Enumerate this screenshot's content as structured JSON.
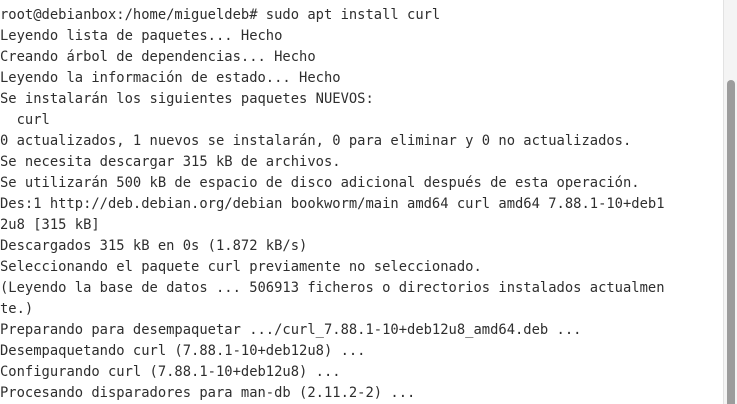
{
  "terminal": {
    "lines": [
      "\u0000",
      "root@debianbox:/home/migueldeb# sudo apt install curl",
      "Leyendo lista de paquetes... Hecho",
      "Creando árbol de dependencias... Hecho",
      "Leyendo la información de estado... Hecho",
      "Se instalarán los siguientes paquetes NUEVOS:",
      "  curl",
      "0 actualizados, 1 nuevos se instalarán, 0 para eliminar y 0 no actualizados.",
      "Se necesita descargar 315 kB de archivos.",
      "Se utilizarán 500 kB de espacio de disco adicional después de esta operación.",
      "Des:1 http://deb.debian.org/debian bookworm/main amd64 curl amd64 7.88.1-10+deb1",
      "2u8 [315 kB]",
      "Descargados 315 kB en 0s (1.872 kB/s)",
      "Seleccionando el paquete curl previamente no seleccionado.",
      "(Leyendo la base de datos ... 506913 ficheros o directorios instalados actualmen",
      "te.)",
      "Preparando para desempaquetar .../curl_7.88.1-10+deb12u8_amd64.deb ...",
      "Desempaquetando curl (7.88.1-10+deb12u8) ...",
      "Configurando curl (7.88.1-10+deb12u8) ...",
      "Procesando disparadores para man-db (2.11.2-2) ..."
    ]
  }
}
